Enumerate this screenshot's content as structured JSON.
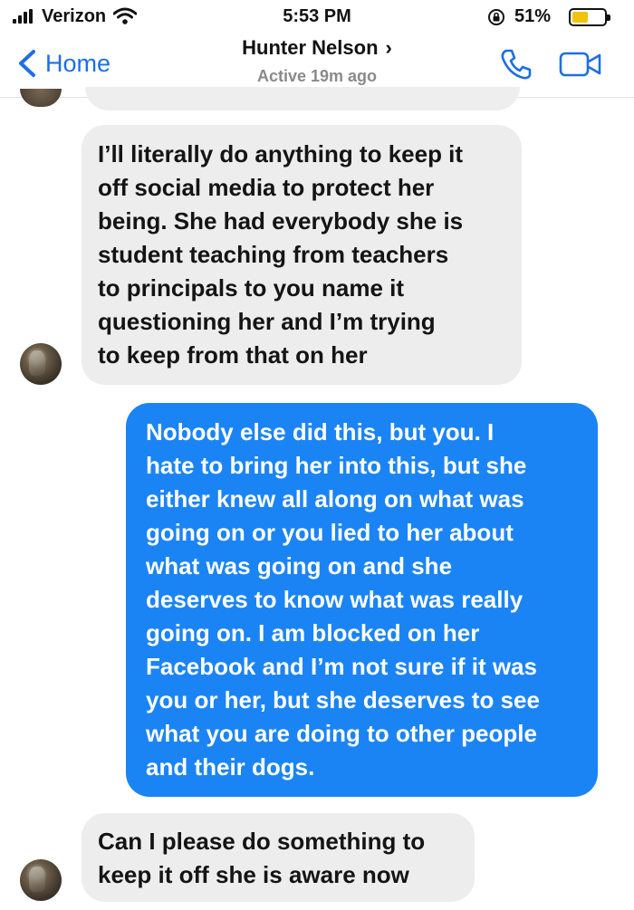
{
  "status_bar": {
    "carrier": "Verizon",
    "time": "5:53 PM",
    "battery_percent": "51%",
    "battery_level": 0.51,
    "icons": [
      "signal-icon",
      "wifi-icon",
      "rotation-lock-icon",
      "battery-icon"
    ]
  },
  "header": {
    "back_label": "Home",
    "contact_name": "Hunter Nelson",
    "contact_chevron": "›",
    "contact_status": "Active 19m ago",
    "icons": [
      "back-chevron-icon",
      "phone-icon",
      "video-camera-icon"
    ],
    "accent_color": "#1d6ee6"
  },
  "messages": [
    {
      "direction": "incoming",
      "text": "I’ll literally do anything to keep it\noff social media to protect her\nbeing. She had everybody she is\nstudent teaching from teachers\nto principals to you name it\nquestioning her and I’m trying\nto keep from that on her"
    },
    {
      "direction": "outgoing",
      "text": "Nobody else did this, but you. I\nhate to bring her into this, but she\neither knew all along on what was\ngoing on or you lied to her about\nwhat was going on and she\ndeserves to know what was really\ngoing on. I am blocked on her\nFacebook and I’m not sure if it was\nyou or her, but she deserves to see\nwhat you are doing to other people\nand their dogs."
    },
    {
      "direction": "incoming",
      "text": "Can I please do something to\nkeep it off she is aware now"
    }
  ],
  "colors": {
    "incoming_bubble": "#ededed",
    "outgoing_bubble": "#1b84f5",
    "battery_fill": "#f2c20f"
  }
}
